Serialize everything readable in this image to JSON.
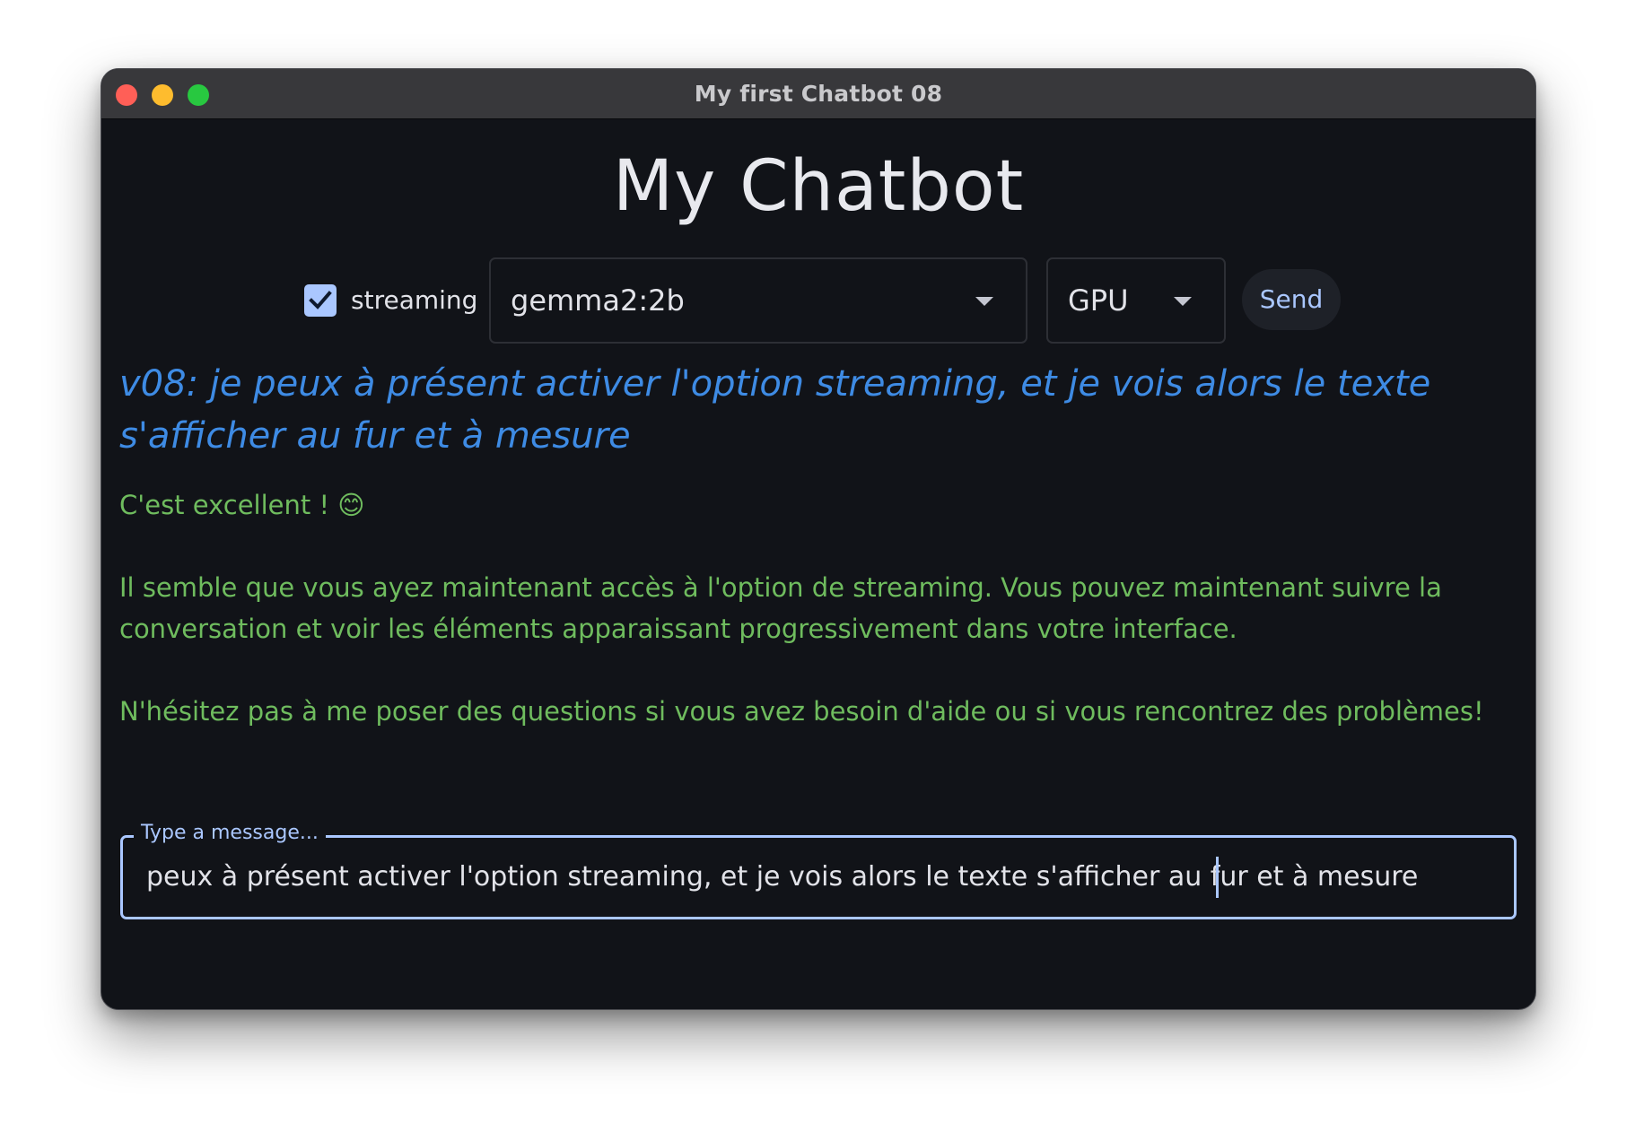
{
  "window": {
    "title": "My first Chatbot 08"
  },
  "app": {
    "title": "My Chatbot"
  },
  "controls": {
    "streaming_label": "streaming",
    "streaming_checked": true,
    "model_selected": "gemma2:2b",
    "device_selected": "GPU",
    "send_label": "Send"
  },
  "conversation": {
    "user_message": "v08: je peux à présent activer l'option streaming, et je vois alors le texte s'afficher au fur et à mesure",
    "bot_paragraphs": [
      "C'est excellent !  😊",
      "Il semble que vous ayez maintenant accès à l'option de streaming. Vous pouvez maintenant suivre la conversation et voir les éléments apparaissant progressivement dans votre interface.",
      "N'hésitez pas à me poser des questions si vous avez besoin d'aide ou si vous rencontrez des problèmes!"
    ]
  },
  "input": {
    "label": "Type a message...",
    "value": "peux à présent activer l'option streaming, et je vois alors le texte s'afficher au fur et à mesure"
  },
  "colors": {
    "background": "#111318",
    "accent": "#aac7ff",
    "user_text": "#3e8be4",
    "bot_text": "#6fbc5e"
  },
  "icons": {
    "checkbox": "check-icon",
    "dropdown": "chevron-down-icon"
  }
}
